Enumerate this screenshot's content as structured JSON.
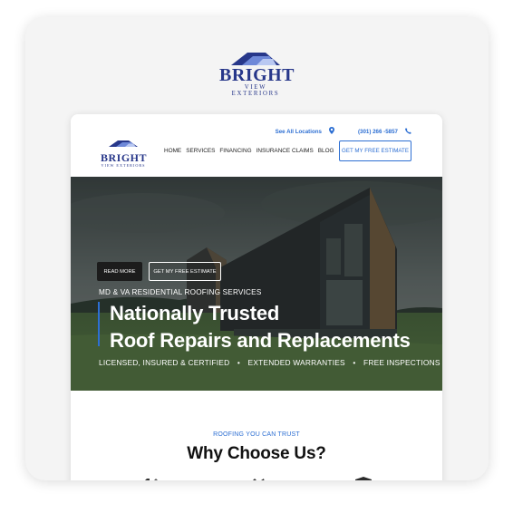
{
  "brand": {
    "name": "BRIGHT",
    "tagline": "VIEW EXTERIORS",
    "roof_color": "#27378a"
  },
  "topbar": {
    "locations_label": "See All Locations",
    "locations_icon": "location-pin-icon",
    "phone_label": "(301) 266 -5857",
    "phone_icon": "phone-icon"
  },
  "nav": {
    "items": [
      {
        "label": "HOME"
      },
      {
        "label": "SERVICES"
      },
      {
        "label": "FINANCING"
      },
      {
        "label": "INSURANCE CLAIMS"
      },
      {
        "label": "BLOG"
      }
    ],
    "cta_label": "GET MY FREE ESTIMATE",
    "accent": "#2d6fd3"
  },
  "hero": {
    "read_more": "READ MORE",
    "estimate": "GET MY FREE ESTIMATE",
    "kicker": "MD & VA RESIDENTIAL ROOFING SERVICES",
    "headline_line1": "Nationally Trusted",
    "headline_line2": "Roof Repairs and Replacements",
    "features": [
      "LICENSED, INSURED & CERTIFIED",
      "EXTENDED WARRANTIES",
      "FREE INSPECTIONS"
    ],
    "separator": "•"
  },
  "section": {
    "kicker": "ROOFING YOU CAN TRUST",
    "title": "Why Choose Us?",
    "feature_icons": [
      "tools-icon",
      "handshake-icon",
      "shield-icon"
    ]
  }
}
